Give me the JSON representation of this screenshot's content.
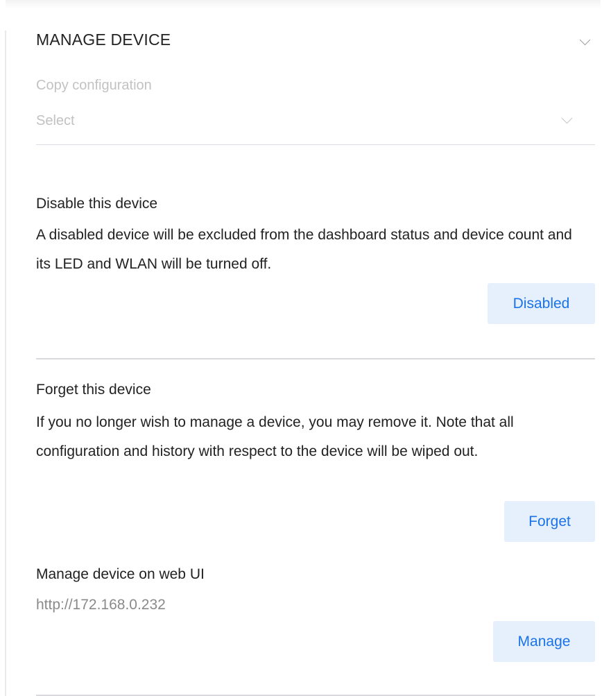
{
  "section": {
    "title": "MANAGE DEVICE"
  },
  "copy_config": {
    "label": "Copy configuration",
    "select_placeholder": "Select"
  },
  "disable": {
    "title": "Disable this device",
    "description": "A disabled device will be excluded from the dashboard status and device count and its LED and WLAN will be turned off.",
    "button_label": "Disabled"
  },
  "forget": {
    "title": "Forget this device",
    "description": "If you no longer wish to manage a device, you may remove it. Note that all configuration and history with respect to the device will be wiped out.",
    "button_label": "Forget"
  },
  "web_ui": {
    "title": "Manage device on web UI",
    "url": "http://172.168.0.232",
    "button_label": "Manage"
  },
  "icons": {
    "collapse": "chevron-down-icon",
    "select": "chevron-down-icon"
  },
  "colors": {
    "accent": "#1a73e8",
    "button_bg": "#e6f0fd",
    "muted_text": "#c2c2c2",
    "divider": "#d9d9de"
  }
}
